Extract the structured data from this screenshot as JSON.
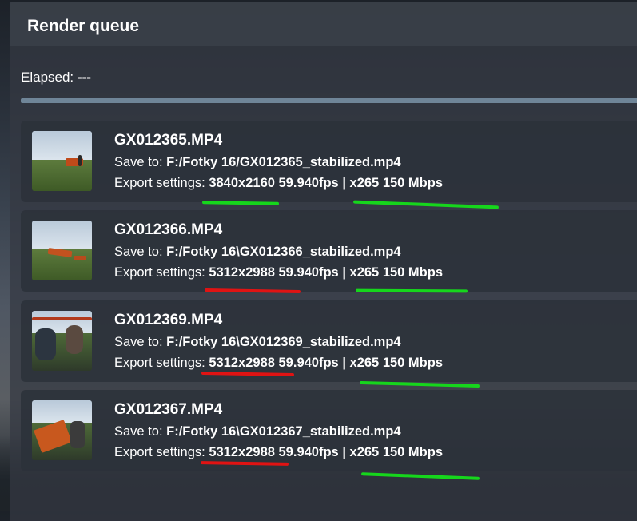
{
  "panel": {
    "title": "Render queue"
  },
  "status": {
    "elapsed_label": "Elapsed:",
    "elapsed_value": "---"
  },
  "colors": {
    "ok_marker": "#16d61c",
    "problem_marker": "#e01313",
    "progress": "#9ab6cf"
  },
  "queue": [
    {
      "name": "GX012365.MP4",
      "save_label": "Save to:",
      "save_path": "F:/Fotky 16/GX012365_stabilized.mp4",
      "export_label": "Export settings:",
      "resolution_fps": "3840x2160 59.940fps",
      "separator": "|",
      "codec": "x265 150 Mbps",
      "resolution_marker": "green",
      "codec_marker": "green"
    },
    {
      "name": "GX012366.MP4",
      "save_label": "Save to:",
      "save_path": "F:/Fotky 16\\GX012366_stabilized.mp4",
      "export_label": "Export settings:",
      "resolution_fps": "5312x2988 59.940fps",
      "separator": "|",
      "codec": "x265 150 Mbps",
      "resolution_marker": "red",
      "codec_marker": "green"
    },
    {
      "name": "GX012369.MP4",
      "save_label": "Save to:",
      "save_path": "F:/Fotky 16\\GX012369_stabilized.mp4",
      "export_label": "Export settings:",
      "resolution_fps": "5312x2988 59.940fps",
      "separator": "|",
      "codec": "x265 150 Mbps",
      "resolution_marker": "red",
      "codec_marker": "green"
    },
    {
      "name": "GX012367.MP4",
      "save_label": "Save to:",
      "save_path": "F:/Fotky 16\\GX012367_stabilized.mp4",
      "export_label": "Export settings:",
      "resolution_fps": "5312x2988 59.940fps",
      "separator": "|",
      "codec": "x265 150 Mbps",
      "resolution_marker": "red",
      "codec_marker": "green"
    }
  ]
}
